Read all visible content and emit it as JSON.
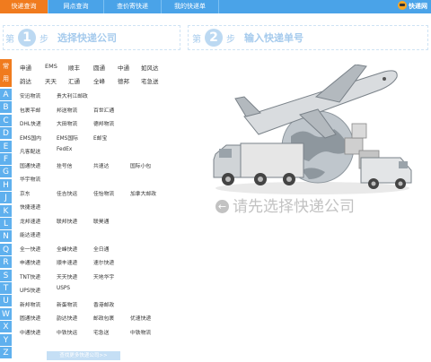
{
  "nav": {
    "tabs": [
      "快递查询",
      "网点查询",
      "查价寄快递",
      "我的快递单"
    ],
    "brand": "快递网"
  },
  "steps": {
    "one": {
      "pre": "第",
      "num": "1",
      "post": "步",
      "title": "选择快递公司"
    },
    "two": {
      "pre": "第",
      "num": "2",
      "post": "步",
      "title": "输入快递单号"
    }
  },
  "common": {
    "tag": "常用",
    "row1": [
      "申通",
      "EMS",
      "顺丰",
      "圆通",
      "中通",
      "如风达"
    ],
    "row2": [
      "韵达",
      "天天",
      "汇通",
      "全峰",
      "德邦",
      "宅急送"
    ]
  },
  "letters": [
    "A",
    "B",
    "C",
    "D",
    "E",
    "F",
    "G",
    "H",
    "J",
    "K",
    "L",
    "N",
    "Q",
    "R",
    "S",
    "T",
    "U",
    "W",
    "X",
    "Y",
    "Z"
  ],
  "companies": {
    "A": [
      [
        "安迅物流",
        "贵大利江邮政"
      ]
    ],
    "B": [
      [
        "包裹平邮",
        "邦送物流",
        "百世汇通"
      ]
    ],
    "D": [
      [
        "DHL快递",
        "大田物流",
        "德邦物流"
      ]
    ],
    "E": [
      [
        "EMS国内",
        "EMS国际",
        "E邮宝"
      ]
    ],
    "F": [
      [
        "凡客配送",
        "FedEx"
      ]
    ],
    "G": [
      [
        "国通快递",
        "挂号信",
        "共速达",
        "国际小包"
      ]
    ],
    "H": [
      [
        "华宇物流"
      ]
    ],
    "J": [
      [
        "京东",
        "佳吉快运",
        "佳怡物流",
        "加拿大邮政"
      ]
    ],
    "K": [
      [
        "快捷速递"
      ]
    ],
    "L": [
      [
        "龙邦速递",
        "联邦快递",
        "联昊通"
      ]
    ],
    "N": [
      [
        "能达速递"
      ]
    ],
    "Q": [
      [
        "全一快递",
        "全峰快递",
        "全日通"
      ]
    ],
    "S": [
      [
        "申通快递",
        "顺丰速递",
        "速尔快递"
      ]
    ],
    "T": [
      [
        "TNT快递",
        "天天快递",
        "天地华宇"
      ]
    ],
    "U": [
      [
        "UPS快递",
        "USPS"
      ]
    ],
    "X": [
      [
        "新邦物流",
        "新蛋物流",
        "香港邮政"
      ]
    ],
    "Y": [
      [
        "圆通快递",
        "韵达快递",
        "邮政包裹",
        "优速快递"
      ]
    ],
    "Z": [
      [
        "中通快递",
        "中铁快运",
        "宅急送",
        "中铁物流"
      ]
    ]
  },
  "more_button": "查找更多快递公司>>",
  "placeholder_text": "请先选择快递公司",
  "colors": {
    "nav_blue": "#4aa3e8",
    "active_orange": "#f07b1e",
    "letter_blue": "#5fb0ee"
  }
}
